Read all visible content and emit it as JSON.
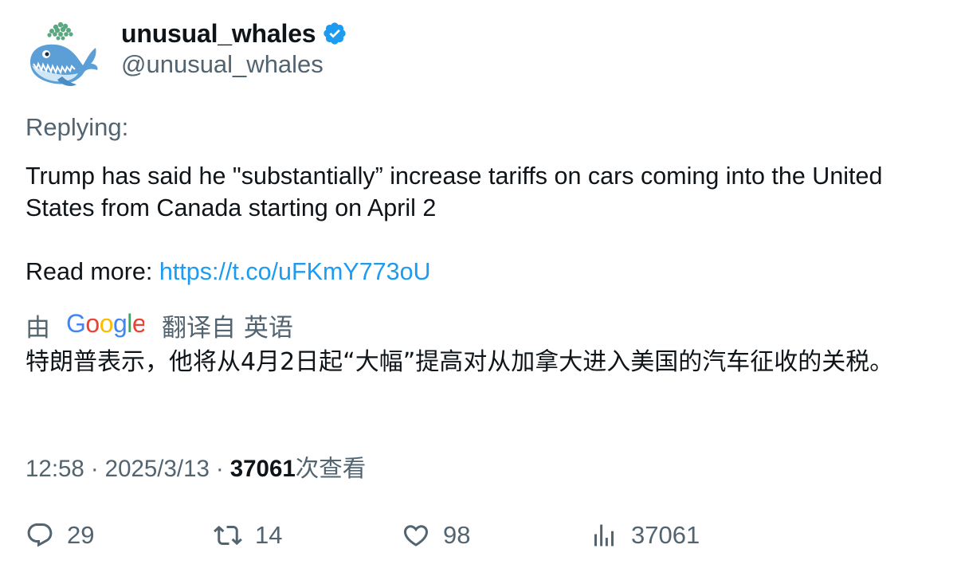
{
  "author": {
    "display_name": "unusual_whales",
    "handle": "@unusual_whales",
    "verified": true,
    "avatar_icon": "whale-avatar-icon"
  },
  "tweet": {
    "replying_label": "Replying:",
    "text": "Trump has said he \"substantially” increase tariffs on cars coming into the United States from Canada starting on April 2",
    "read_more_label": "Read more: ",
    "link": "https://t.co/uFKmY773oU"
  },
  "translation": {
    "by_label": "由",
    "provider": "Google",
    "from_label": "翻译自 英语",
    "text": "特朗普表示，他将从4月2日起“大幅”提高对从加拿大进入美国的汽车征收的关税。"
  },
  "meta": {
    "time": "12:58",
    "separator": "·",
    "date": "2025/3/13",
    "views_count": "37061",
    "views_label": "次查看"
  },
  "actions": {
    "replies": "29",
    "retweets": "14",
    "likes": "98",
    "views": "37061"
  },
  "colors": {
    "link": "#1d9bf0",
    "secondary_text": "#536471",
    "primary_text": "#0f1419",
    "verified_badge": "#1d9bf0"
  }
}
